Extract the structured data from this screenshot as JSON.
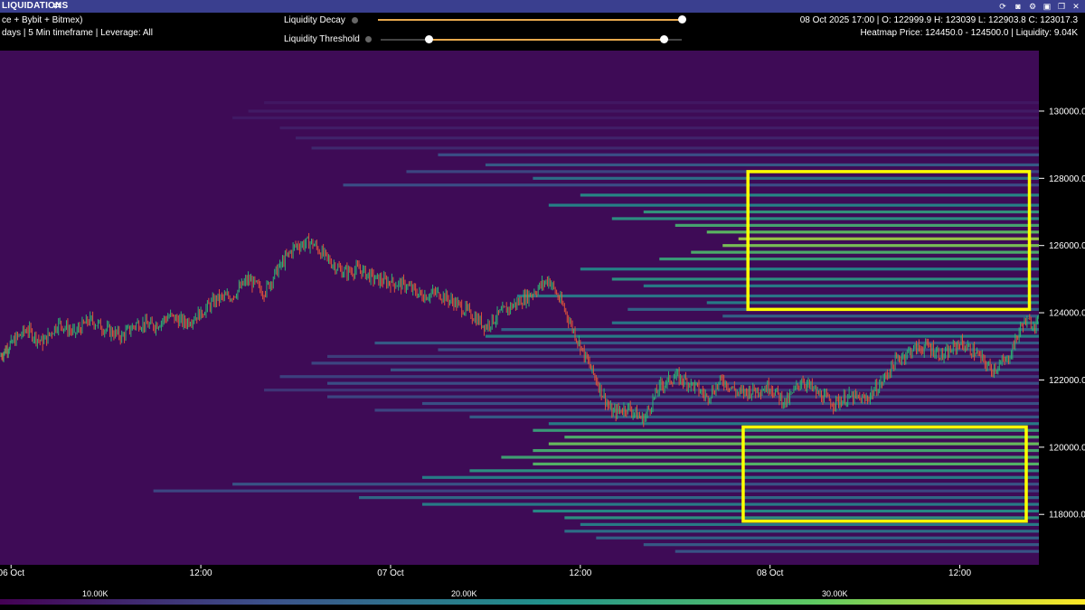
{
  "header": {
    "title": "LIQUIDATIONS",
    "subtitle_line1": "ce + Bybit + Bitmex)",
    "subtitle_line2": "days | 5 Min timeframe | Leverage: All",
    "icons": [
      "refresh-icon",
      "camera-icon",
      "gear-icon",
      "save-icon",
      "copy-icon",
      "close-icon"
    ]
  },
  "controls": {
    "decay_label": "Liquidity Decay",
    "threshold_label": "Liquidity Threshold",
    "decay_value": 1.0,
    "threshold_low": 0.16,
    "threshold_high": 0.94
  },
  "ohlc_info": "08 Oct 2025 17:00 | O: 122999.9 H: 123039 L: 122903.8 C: 123017.3",
  "heatmap_info": "Heatmap Price: 124450.0 - 124500.0 | Liquidity: 9.04K",
  "colors": {
    "background": "#3e0b56",
    "price_up": "#2bb673",
    "price_down": "#e0533a",
    "highlight": "#ffff00",
    "axis_bg": "#000000"
  },
  "chart_data": {
    "type": "heatmap",
    "x_tick_labels": [
      "06 Oct",
      "12:00",
      "07 Oct",
      "12:00",
      "08 Oct",
      "12:00"
    ],
    "x_tick_hours": [
      0,
      12,
      24,
      36,
      48,
      60
    ],
    "x_range_hours": [
      -0.7,
      65
    ],
    "y_tick_labels": [
      "130000.0",
      "128000.0",
      "126000.0",
      "124000.0",
      "122000.0",
      "120000.0",
      "118000.0"
    ],
    "y_ticks": [
      130000,
      128000,
      126000,
      124000,
      122000,
      120000,
      118000
    ],
    "ylim": [
      116500,
      131800
    ],
    "colorbar_labels": [
      "10.00K",
      "20.00K",
      "30.00K"
    ],
    "colorbar_values": [
      10000,
      20000,
      30000
    ],
    "colorbar_range": [
      0,
      35000
    ],
    "price_series": {
      "hours": [
        -0.7,
        0,
        1,
        2,
        3,
        4,
        5,
        6,
        7,
        8,
        9,
        10,
        11,
        12,
        13,
        14,
        15,
        16,
        17,
        18,
        19,
        20,
        21,
        22,
        23,
        24,
        25,
        26,
        27,
        28,
        29,
        30,
        31,
        32,
        33,
        34,
        35,
        36,
        37,
        38,
        39,
        40,
        41,
        42,
        43,
        44,
        45,
        46,
        47,
        48,
        49,
        50,
        51,
        52,
        53,
        54,
        55,
        56,
        57,
        58,
        59,
        60,
        61,
        62,
        63,
        64,
        65
      ],
      "close": [
        122700,
        123100,
        123500,
        123100,
        123700,
        123400,
        123800,
        123500,
        123300,
        123700,
        123600,
        123900,
        123700,
        124000,
        124400,
        124500,
        125000,
        124600,
        125400,
        126000,
        126100,
        125600,
        125200,
        125300,
        125000,
        124900,
        124800,
        124500,
        124600,
        124300,
        124000,
        123600,
        124000,
        124300,
        124600,
        125000,
        124100,
        123000,
        122000,
        121000,
        121200,
        120800,
        121800,
        122100,
        121900,
        121500,
        122000,
        121600,
        121700,
        121800,
        121300,
        122000,
        121600,
        121300,
        121500,
        121400,
        121900,
        122600,
        122900,
        123000,
        122700,
        123100,
        122800,
        122300,
        122600,
        123700,
        123700
      ],
      "range_hl": 450
    },
    "liquidity_bands": [
      {
        "price": 130250,
        "start_h": 16,
        "liq": 2500
      },
      {
        "price": 130000,
        "start_h": 15,
        "liq": 3000
      },
      {
        "price": 129800,
        "start_h": 14,
        "liq": 2800
      },
      {
        "price": 129500,
        "start_h": 17,
        "liq": 3200
      },
      {
        "price": 129200,
        "start_h": 18,
        "liq": 4000
      },
      {
        "price": 128900,
        "start_h": 19,
        "liq": 4500
      },
      {
        "price": 128700,
        "start_h": 27,
        "liq": 9000
      },
      {
        "price": 128400,
        "start_h": 30,
        "liq": 11000
      },
      {
        "price": 128200,
        "start_h": 25,
        "liq": 8000
      },
      {
        "price": 128000,
        "start_h": 33,
        "liq": 14000
      },
      {
        "price": 127800,
        "start_h": 21,
        "liq": 9000
      },
      {
        "price": 127500,
        "start_h": 36,
        "liq": 18000
      },
      {
        "price": 127200,
        "start_h": 34,
        "liq": 17000
      },
      {
        "price": 127000,
        "start_h": 40,
        "liq": 20000
      },
      {
        "price": 126800,
        "start_h": 38,
        "liq": 19000
      },
      {
        "price": 126600,
        "start_h": 42,
        "liq": 23000
      },
      {
        "price": 126400,
        "start_h": 44,
        "liq": 26000
      },
      {
        "price": 126200,
        "start_h": 46,
        "liq": 30000
      },
      {
        "price": 126000,
        "start_h": 45,
        "liq": 28000
      },
      {
        "price": 125800,
        "start_h": 43,
        "liq": 24000
      },
      {
        "price": 125600,
        "start_h": 41,
        "liq": 21000
      },
      {
        "price": 125300,
        "start_h": 36,
        "liq": 17000
      },
      {
        "price": 125000,
        "start_h": 38,
        "liq": 19000
      },
      {
        "price": 124800,
        "start_h": 40,
        "liq": 16000
      },
      {
        "price": 124500,
        "start_h": 32,
        "liq": 15000
      },
      {
        "price": 124300,
        "start_h": 44,
        "liq": 16000
      },
      {
        "price": 124100,
        "start_h": 39,
        "liq": 12000
      },
      {
        "price": 123900,
        "start_h": 45,
        "liq": 12000
      },
      {
        "price": 123700,
        "start_h": 38,
        "liq": 15000
      },
      {
        "price": 123500,
        "start_h": 31,
        "liq": 12000
      },
      {
        "price": 123300,
        "start_h": 30,
        "liq": 16000
      },
      {
        "price": 123100,
        "start_h": 23,
        "liq": 11000
      },
      {
        "price": 122900,
        "start_h": 27,
        "liq": 9000
      },
      {
        "price": 122700,
        "start_h": 20,
        "liq": 7000
      },
      {
        "price": 122500,
        "start_h": 19,
        "liq": 8000
      },
      {
        "price": 122300,
        "start_h": 24,
        "liq": 10000
      },
      {
        "price": 122100,
        "start_h": 17,
        "liq": 7500
      },
      {
        "price": 121900,
        "start_h": 20,
        "liq": 9000
      },
      {
        "price": 121700,
        "start_h": 16,
        "liq": 6000
      },
      {
        "price": 121500,
        "start_h": 20,
        "liq": 8000
      },
      {
        "price": 121300,
        "start_h": 26,
        "liq": 9500
      },
      {
        "price": 121100,
        "start_h": 23,
        "liq": 8000
      },
      {
        "price": 120900,
        "start_h": 29,
        "liq": 11000
      },
      {
        "price": 120700,
        "start_h": 34,
        "liq": 16000
      },
      {
        "price": 120500,
        "start_h": 33,
        "liq": 21000
      },
      {
        "price": 120300,
        "start_h": 35,
        "liq": 24000
      },
      {
        "price": 120100,
        "start_h": 34,
        "liq": 27000
      },
      {
        "price": 119900,
        "start_h": 33,
        "liq": 23000
      },
      {
        "price": 119700,
        "start_h": 31,
        "liq": 22000
      },
      {
        "price": 119500,
        "start_h": 33,
        "liq": 25000
      },
      {
        "price": 119300,
        "start_h": 29,
        "liq": 19000
      },
      {
        "price": 119100,
        "start_h": 26,
        "liq": 16000
      },
      {
        "price": 118900,
        "start_h": 14,
        "liq": 10000
      },
      {
        "price": 118700,
        "start_h": 9,
        "liq": 8000
      },
      {
        "price": 118500,
        "start_h": 22,
        "liq": 13000
      },
      {
        "price": 118300,
        "start_h": 26,
        "liq": 16000
      },
      {
        "price": 118100,
        "start_h": 33,
        "liq": 18000
      },
      {
        "price": 117900,
        "start_h": 35,
        "liq": 19000
      },
      {
        "price": 117700,
        "start_h": 36,
        "liq": 16000
      },
      {
        "price": 117500,
        "start_h": 35,
        "liq": 14000
      },
      {
        "price": 117300,
        "start_h": 37,
        "liq": 12000
      },
      {
        "price": 117100,
        "start_h": 40,
        "liq": 11000
      },
      {
        "price": 116900,
        "start_h": 42,
        "liq": 10000
      }
    ],
    "highlight_boxes": [
      {
        "h0": 46.6,
        "h1": 64.4,
        "p0": 124100,
        "p1": 128200
      },
      {
        "h0": 46.3,
        "h1": 64.2,
        "p0": 117800,
        "p1": 120600
      }
    ]
  }
}
